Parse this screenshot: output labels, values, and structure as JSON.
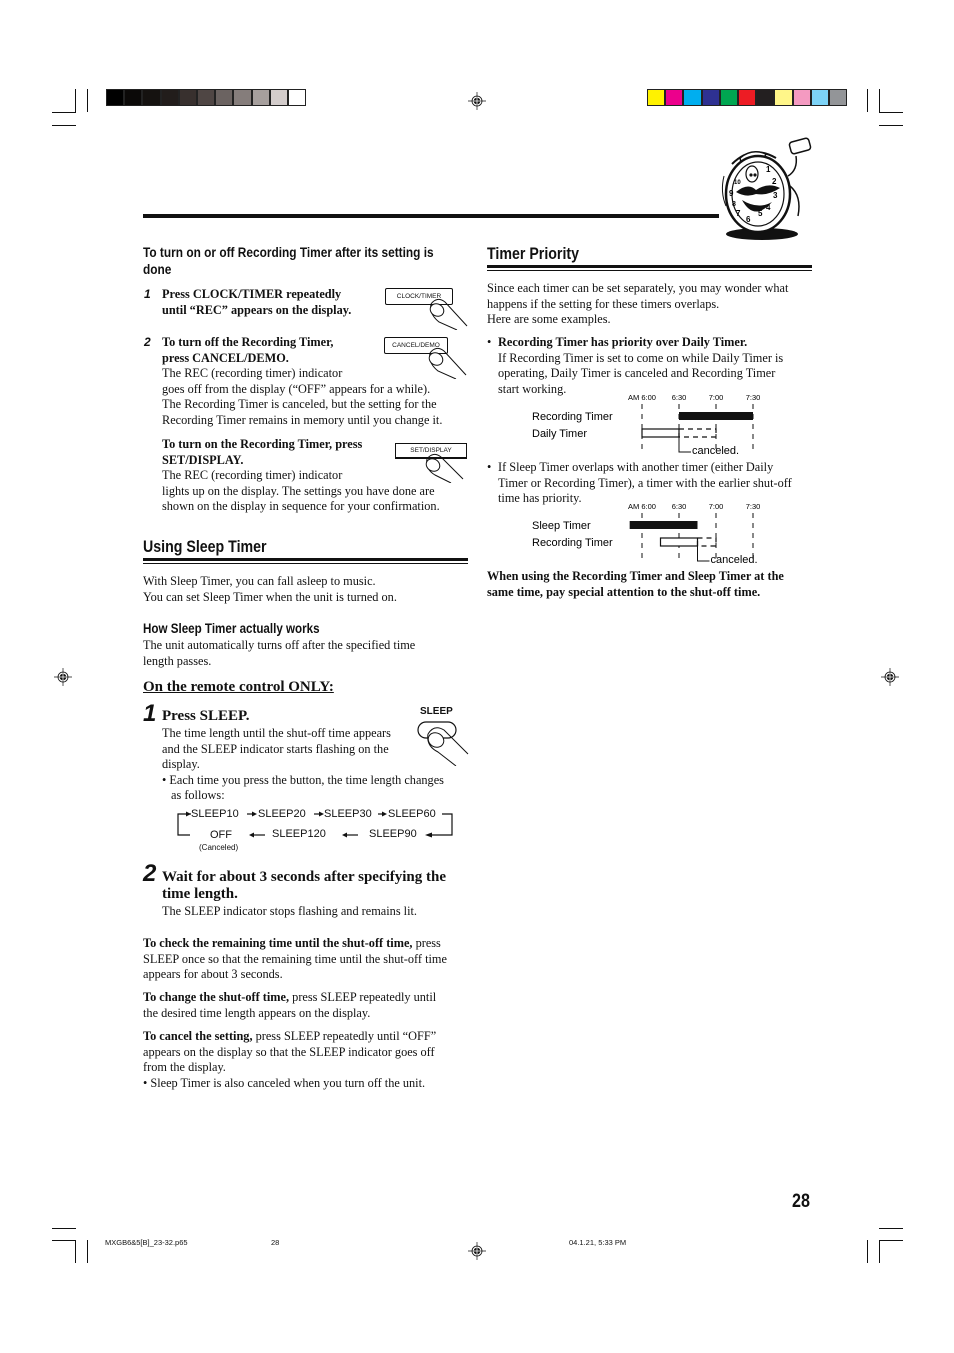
{
  "print_marks": {
    "gray_swatches": [
      "#000000",
      "#0b0908",
      "#151210",
      "#221d1b",
      "#38302e",
      "#4f4644",
      "#6b6361",
      "#857d7b",
      "#a69f9d",
      "#d3cccb",
      "#ffffff"
    ],
    "color_swatches": [
      "#fff200",
      "#ec008c",
      "#00aeef",
      "#2e3192",
      "#00a651",
      "#ed1c24",
      "#231f20",
      "#fff689",
      "#f49ac1",
      "#7dd3f7",
      "#939598"
    ]
  },
  "left": {
    "recording_toggle": {
      "title_line1": "To turn on or off Recording Timer after its setting is",
      "title_line2": "done",
      "step1": {
        "num": "1",
        "line1": "Press CLOCK/TIMER repeatedly",
        "line2": "until “REC” appears on the display.",
        "button_label": "CLOCK/TIMER"
      },
      "step2": {
        "num": "2",
        "line1": "To turn off the Recording Timer,",
        "line2": "press CANCEL/DEMO.",
        "button_label": "CANCEL/DEMO",
        "body": [
          "The REC (recording timer) indicator",
          "goes off from the display (“OFF” appears for a while).",
          "The Recording Timer is canceled, but the setting for the",
          "Recording Timer remains in memory until you change it."
        ]
      },
      "turn_on": {
        "line1": "To turn on the Recording Timer, press",
        "line2": "SET/DISPLAY.",
        "button_label": "SET/DISPLAY",
        "body": [
          "The REC (recording timer) indicator",
          "lights up on the display. The settings you have done are",
          "shown on the display in sequence for your confirmation."
        ]
      }
    },
    "sleep": {
      "heading": "Using Sleep Timer",
      "intro": [
        "With Sleep Timer, you can fall asleep to music.",
        "You can set Sleep Timer when the unit is turned on."
      ],
      "how_title": "How Sleep Timer actually works",
      "how_body": [
        "The unit automatically turns off after the specified time",
        "length passes."
      ],
      "remote_only": "On the remote control ONLY:",
      "step1": {
        "num": "1",
        "title": "Press SLEEP.",
        "button_label": "SLEEP",
        "body": [
          "The time length until the shut-off time appears",
          "and the SLEEP indicator starts flashing on the",
          "display."
        ],
        "bullet": [
          "• Each time you press the button, the time length changes",
          "as follows:"
        ]
      },
      "cycle": {
        "top": [
          "SLEEP10",
          "SLEEP20",
          "SLEEP30",
          "SLEEP60"
        ],
        "bottom": [
          "OFF",
          "SLEEP120",
          "SLEEP90"
        ],
        "off_note": "(Canceled)"
      },
      "step2": {
        "num": "2",
        "title_line1": "Wait for about 3 seconds after specifying the",
        "title_line2": "time length.",
        "body": "The SLEEP indicator stops flashing and remains lit."
      },
      "check": {
        "bold": "To check the remaining time until the shut-off time,",
        "rest1": " press",
        "line2": "SLEEP once so that the remaining time until the shut-off time",
        "line3": "appears for about 3 seconds."
      },
      "change": {
        "bold": "To change the shut-off time,",
        "rest1": " press SLEEP repeatedly until",
        "line2": "the desired time length appears on the display."
      },
      "cancel": {
        "bold": "To cancel the setting,",
        "rest1": " press SLEEP repeatedly until “OFF”",
        "line2": "appears on the display so that the SLEEP indicator goes off",
        "line3": "from the display.",
        "bullet": "•  Sleep Timer is also canceled when you turn off the unit."
      }
    }
  },
  "right": {
    "heading": "Timer Priority",
    "intro": [
      "Since each timer can be set separately, you may wonder what",
      "happens if the setting for these timers overlaps.",
      "Here are some examples."
    ],
    "example1": {
      "bullet_title": "Recording Timer has priority over Daily Timer.",
      "body": [
        "If Recording Timer is set to come on while Daily Timer is",
        "operating, Daily Timer is canceled and Recording Timer",
        "start working."
      ]
    },
    "example2": {
      "body": [
        "If Sleep Timer overlaps with another timer (either Daily",
        "Timer or Recording Timer), a timer with the earlier shut-off",
        "time has priority."
      ]
    },
    "warning": [
      "When using the Recording Timer and Sleep Timer at the",
      "same time, pay special attention to the shut-off time."
    ]
  },
  "chart_data": [
    {
      "type": "timeline",
      "ticks": [
        "AM 6:00",
        "6:30",
        "7:00",
        "7:30"
      ],
      "tick_values_min": [
        0,
        30,
        60,
        90
      ],
      "rows": [
        {
          "label": "Recording Timer",
          "segments": [
            {
              "start": 30,
              "end": 90,
              "style": "solid"
            }
          ]
        },
        {
          "label": "Daily Timer",
          "segments": [
            {
              "start": 0,
              "end": 30,
              "style": "outline"
            },
            {
              "start": 30,
              "end": 60,
              "style": "dashed"
            }
          ]
        }
      ],
      "annotation": "canceled."
    },
    {
      "type": "timeline",
      "ticks": [
        "AM 6:00",
        "6:30",
        "7:00",
        "7:30"
      ],
      "tick_values_min": [
        0,
        30,
        60,
        90
      ],
      "rows": [
        {
          "label": "Sleep Timer",
          "segments": [
            {
              "start": -10,
              "end": 45,
              "style": "solid"
            }
          ]
        },
        {
          "label": "Recording Timer",
          "segments": [
            {
              "start": 15,
              "end": 45,
              "style": "outline"
            },
            {
              "start": 45,
              "end": 60,
              "style": "dashed"
            }
          ]
        }
      ],
      "annotation": "canceled."
    }
  ],
  "page_number": "28",
  "footer": {
    "file": "MXGB6&5[B]_23-32.p65",
    "page": "28",
    "timestamp": "04.1.21, 5:33 PM"
  }
}
